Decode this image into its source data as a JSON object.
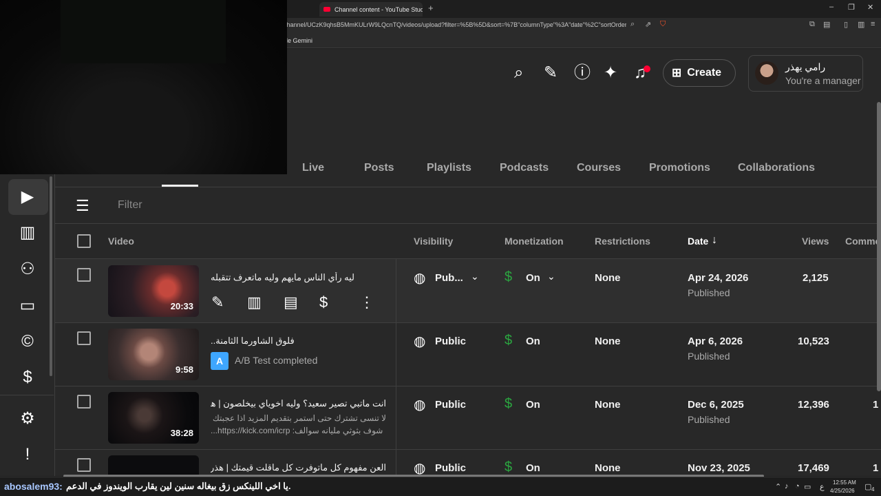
{
  "browser": {
    "tab_title": "Channel content - YouTube Studio",
    "tab_close": "×",
    "new_tab": "+",
    "url": "channel/UCzK9qhsB5MmKULrW9LQcnTQ/videos/upload?filter=%5B%5D&sort=%7B\"columnType\"%3A\"date\"%2C\"sortOrder\"%3...",
    "bookmark_gemini": "le Gemini",
    "window_controls": [
      "–",
      "❐",
      "✕"
    ]
  },
  "header": {
    "create_label": "Create",
    "account_name": "رامي يهذر",
    "account_role": "You're a manager"
  },
  "content_tabs": [
    "Live",
    "Posts",
    "Playlists",
    "Podcasts",
    "Courses",
    "Promotions",
    "Collaborations"
  ],
  "filter": {
    "placeholder": "Filter"
  },
  "table": {
    "headers": {
      "video": "Video",
      "visibility": "Visibility",
      "monetization": "Monetization",
      "restrictions": "Restrictions",
      "date": "Date",
      "date_sort_icon": "↓",
      "views": "Views",
      "comments": "Comme"
    },
    "rows": [
      {
        "title": "ليه رأي الناس مايهم وليه ماتعرف تتقبله",
        "duration": "20:33",
        "visibility": "Pub...",
        "monetization": "On",
        "restrictions": "None",
        "date": "Apr 24, 2026",
        "status": "Published",
        "views": "2,125"
      },
      {
        "title": "فلوق الشاورما الثامنة..",
        "duration": "9:58",
        "ab_test": "A/B Test completed",
        "visibility": "Public",
        "monetization": "On",
        "restrictions": "None",
        "date": "Apr 6, 2026",
        "status": "Published",
        "views": "10,523"
      },
      {
        "title": "انت ماتبي تصير سعيد؟ وليه اخوياي بيخلصون | هذر ...",
        "desc1": "لا تنسى تشترك حتى استمر بتقديم المزيد اذا عجبتك سوالفي",
        "desc2": "شوف بثوثي مليانه سوالف: https://kick.com/icrp...",
        "duration": "38:28",
        "visibility": "Public",
        "monetization": "On",
        "restrictions": "None",
        "date": "Dec 6, 2025",
        "status": "Published",
        "views": "12,396",
        "comments": "1"
      },
      {
        "title": "العن مفهوم كل ماتوفرت كل ماقلت قيمتك | هذر",
        "visibility": "Public",
        "monetization": "On",
        "restrictions": "None",
        "date": "Nov 23, 2025",
        "views": "17,469",
        "comments": "1"
      }
    ]
  },
  "overlay_chat": {
    "user": "abosalem93:",
    "message": "يا اخي اللينكس زق بيغاله سنين لين يقارب الويندوز في الدعم."
  },
  "taskbar": {
    "lang": "ع",
    "time": "12:55 AM",
    "date": "4/25/2026",
    "notif_count": "4"
  }
}
